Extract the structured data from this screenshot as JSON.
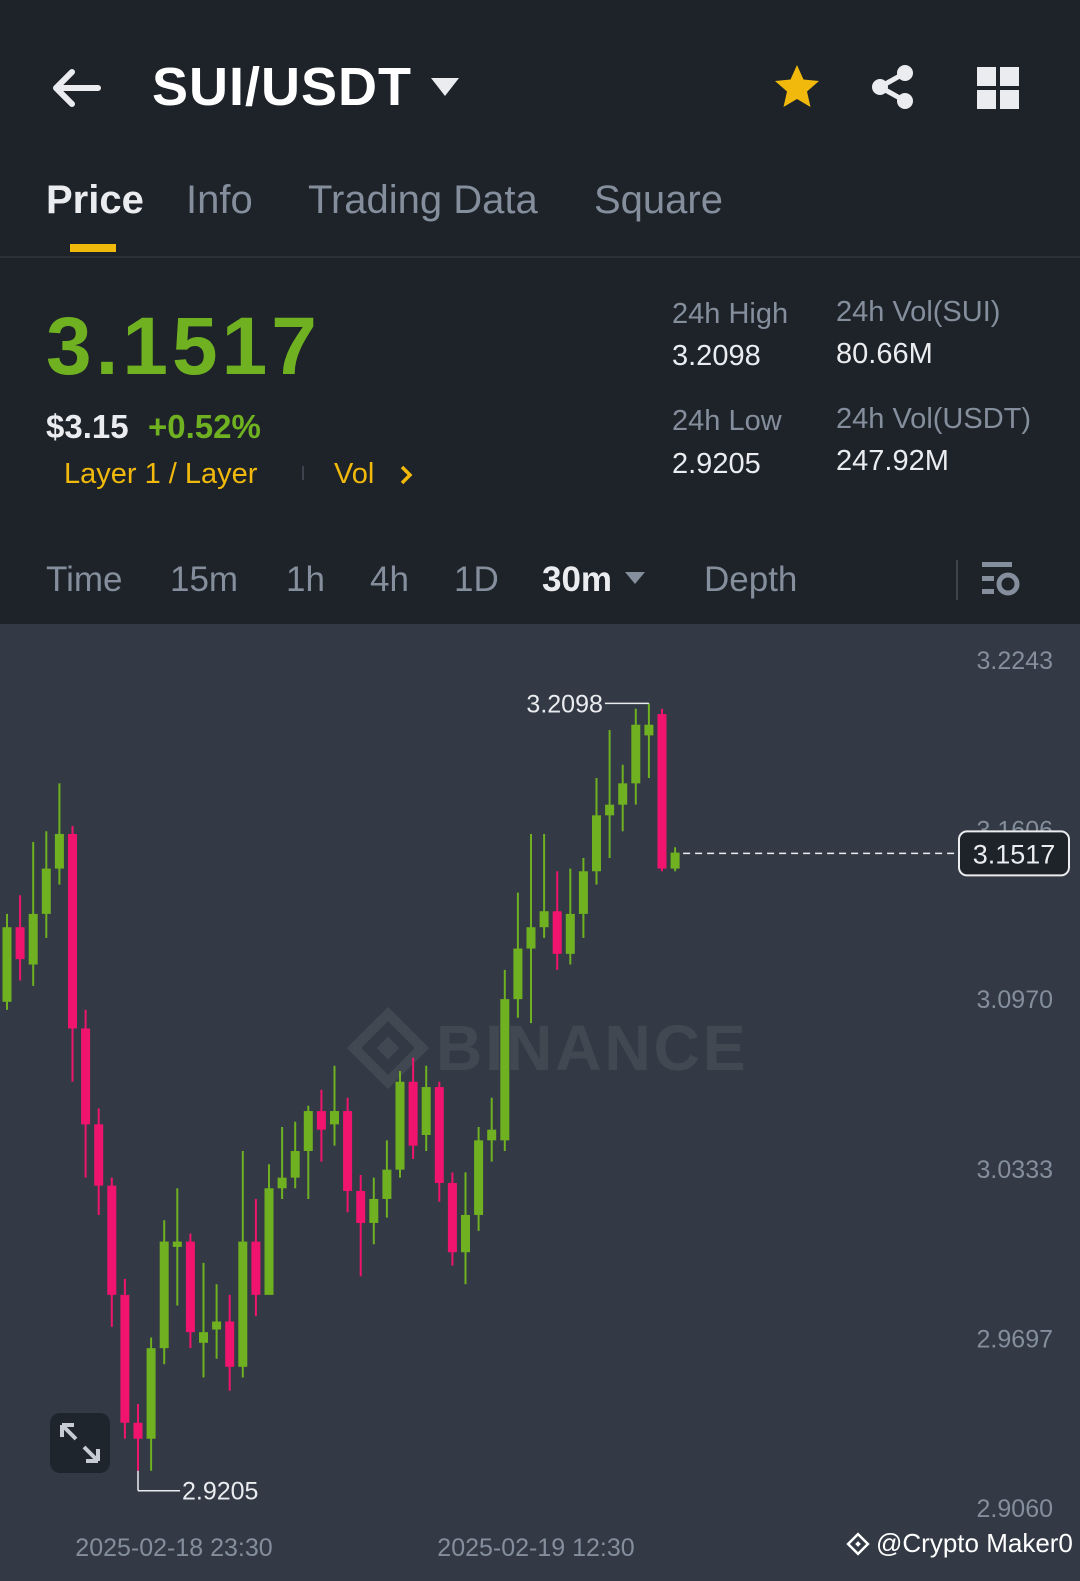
{
  "header": {
    "pair": "SUI/USDT",
    "icons": {
      "back": "arrow-left-icon",
      "favorite": "star-icon",
      "share": "share-icon",
      "more": "grid-icon"
    },
    "favorite_color": "#f0b90b"
  },
  "tabs": [
    {
      "label": "Price",
      "active": true
    },
    {
      "label": "Info",
      "active": false
    },
    {
      "label": "Trading Data",
      "active": false
    },
    {
      "label": "Square",
      "active": false
    }
  ],
  "ticker": {
    "last_price": "3.1517",
    "usd_price": "$3.15",
    "change": "+0.52%",
    "tag": "Layer 1 / Layer",
    "vol_link": "Vol",
    "stats": {
      "high_label": "24h High",
      "high_value": "3.2098",
      "low_label": "24h Low",
      "low_value": "2.9205",
      "vol_sui_label": "24h Vol(SUI)",
      "vol_sui_value": "80.66M",
      "vol_usdt_label": "24h Vol(USDT)",
      "vol_usdt_value": "247.92M"
    }
  },
  "intervals": {
    "items": [
      "Time",
      "15m",
      "1h",
      "4h",
      "1D",
      "30m",
      "Depth"
    ],
    "active": "30m"
  },
  "colors": {
    "up": "#6fb120",
    "down": "#f0146e",
    "accent": "#f0b90b",
    "bg": "#1e2329",
    "chart_bg": "#333a45"
  },
  "chart_data": {
    "type": "candlestick",
    "y_ticks": [
      "3.2243",
      "3.1606",
      "3.0970",
      "3.0333",
      "2.9697",
      "2.9060"
    ],
    "ylim": [
      2.906,
      3.2243
    ],
    "x_ticks": [
      "2025-02-18 23:30",
      "2025-02-19 12:30"
    ],
    "current_price": "3.1517",
    "high_marker": "3.2098",
    "low_marker": "2.9205",
    "watermark": "BINANCE",
    "credit": "@Crypto Maker0",
    "candles": [
      [
        3.096,
        3.124,
        3.129,
        3.093
      ],
      [
        3.124,
        3.112,
        3.136,
        3.104
      ],
      [
        3.11,
        3.129,
        3.156,
        3.102
      ],
      [
        3.129,
        3.146,
        3.16,
        3.12
      ],
      [
        3.146,
        3.159,
        3.178,
        3.14
      ],
      [
        3.159,
        3.086,
        3.162,
        3.066
      ],
      [
        3.086,
        3.05,
        3.093,
        3.03
      ],
      [
        3.05,
        3.027,
        3.056,
        3.016
      ],
      [
        3.027,
        2.986,
        3.03,
        2.974
      ],
      [
        2.986,
        2.938,
        2.992,
        2.932
      ],
      [
        2.938,
        2.932,
        2.945,
        2.92
      ],
      [
        2.932,
        2.966,
        2.97,
        2.92
      ],
      [
        2.966,
        3.006,
        3.014,
        2.96
      ],
      [
        3.004,
        3.006,
        3.026,
        2.982
      ],
      [
        3.006,
        2.972,
        3.009,
        2.966
      ],
      [
        2.968,
        2.972,
        2.998,
        2.955
      ],
      [
        2.973,
        2.976,
        2.99,
        2.962
      ],
      [
        2.976,
        2.959,
        2.986,
        2.95
      ],
      [
        2.959,
        3.006,
        3.04,
        2.955
      ],
      [
        3.006,
        2.986,
        3.022,
        2.978
      ],
      [
        2.986,
        3.026,
        3.035,
        2.99
      ],
      [
        3.026,
        3.03,
        3.049,
        3.022
      ],
      [
        3.03,
        3.04,
        3.051,
        3.026
      ],
      [
        3.04,
        3.055,
        3.057,
        3.022
      ],
      [
        3.055,
        3.048,
        3.063,
        3.036
      ],
      [
        3.05,
        3.055,
        3.072,
        3.042
      ],
      [
        3.055,
        3.025,
        3.06,
        3.017
      ],
      [
        3.025,
        3.013,
        3.031,
        2.993
      ],
      [
        3.013,
        3.022,
        3.03,
        3.005
      ],
      [
        3.022,
        3.033,
        3.044,
        3.015
      ],
      [
        3.033,
        3.066,
        3.07,
        3.03
      ],
      [
        3.066,
        3.042,
        3.075,
        3.037
      ],
      [
        3.046,
        3.064,
        3.072,
        3.04
      ],
      [
        3.064,
        3.028,
        3.066,
        3.021
      ],
      [
        3.028,
        3.002,
        3.032,
        2.997
      ],
      [
        3.002,
        3.016,
        3.032,
        2.99
      ],
      [
        3.016,
        3.044,
        3.049,
        3.01
      ],
      [
        3.044,
        3.048,
        3.06,
        3.036
      ],
      [
        3.044,
        3.097,
        3.108,
        3.04
      ],
      [
        3.097,
        3.116,
        3.137,
        3.09
      ],
      [
        3.116,
        3.124,
        3.159,
        3.088
      ],
      [
        3.124,
        3.13,
        3.159,
        3.12
      ],
      [
        3.13,
        3.114,
        3.145,
        3.108
      ],
      [
        3.114,
        3.129,
        3.146,
        3.11
      ],
      [
        3.129,
        3.145,
        3.15,
        3.12
      ],
      [
        3.145,
        3.166,
        3.18,
        3.14
      ],
      [
        3.166,
        3.17,
        3.198,
        3.15
      ],
      [
        3.17,
        3.178,
        3.185,
        3.16
      ],
      [
        3.178,
        3.2,
        3.206,
        3.17
      ],
      [
        3.196,
        3.2,
        3.208,
        3.18
      ],
      [
        3.204,
        3.146,
        3.206,
        3.145
      ],
      [
        3.146,
        3.152,
        3.154,
        3.145
      ]
    ]
  }
}
